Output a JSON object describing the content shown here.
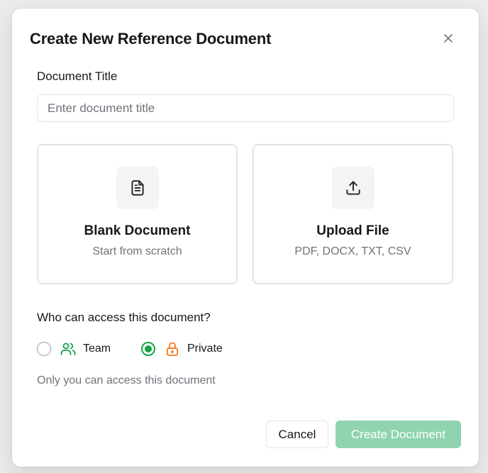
{
  "modal": {
    "title": "Create New Reference Document",
    "close_icon": "close-icon"
  },
  "document_title": {
    "label": "Document Title",
    "placeholder": "Enter document title",
    "value": ""
  },
  "options": {
    "blank": {
      "icon": "document-icon",
      "title": "Blank Document",
      "subtitle": "Start from scratch"
    },
    "upload": {
      "icon": "upload-icon",
      "title": "Upload File",
      "subtitle": "PDF, DOCX, TXT, CSV"
    }
  },
  "access": {
    "label": "Who can access this document?",
    "team": {
      "label": "Team",
      "icon": "users-icon",
      "selected": false
    },
    "private": {
      "label": "Private",
      "icon": "lock-icon",
      "selected": true
    },
    "helper": "Only you can access this document"
  },
  "actions": {
    "cancel": "Cancel",
    "create": "Create Document"
  },
  "colors": {
    "accent_green": "#16a34a",
    "create_button_disabled": "#8fd4ae",
    "lock_orange": "#f97316",
    "team_green": "#16a34a"
  }
}
